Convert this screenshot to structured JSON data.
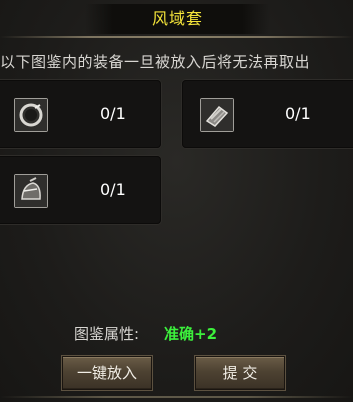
{
  "title": "风域套",
  "notice": "以下图鉴内的装备一旦被放入后将无法再取出",
  "slots": [
    {
      "icon": "ring-icon",
      "count": "0/1"
    },
    {
      "icon": "bracer-icon",
      "count": "0/1"
    },
    {
      "icon": "helmet-icon",
      "count": "0/1"
    }
  ],
  "footer": {
    "attr_label": "图鉴属性:",
    "attr_value": "准确+2",
    "attr_value_color": "#3cf03c"
  },
  "buttons": {
    "put_all": "一键放入",
    "submit": "提 交"
  },
  "colors": {
    "title": "#f4e43a",
    "text": "#d8d6d2"
  }
}
